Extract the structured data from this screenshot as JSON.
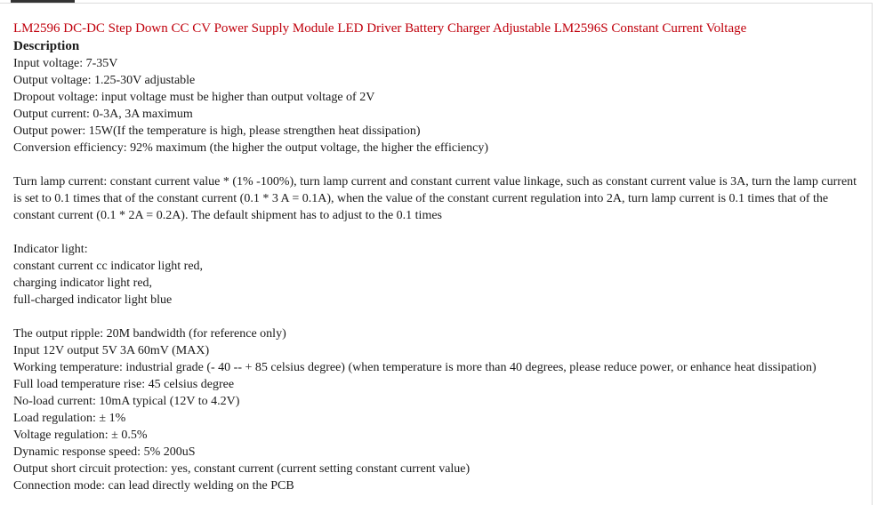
{
  "title": "LM2596 DC-DC Step Down CC CV Power Supply Module LED Driver Battery Charger Adjustable LM2596S Constant Current Voltage",
  "description_heading": "Description",
  "specs": [
    "Input voltage: 7-35V",
    "Output voltage: 1.25-30V adjustable",
    "Dropout voltage: input voltage must be higher than output voltage of 2V",
    "Output current: 0-3A, 3A maximum",
    "Output power: 15W(If the temperature is high, please strengthen heat dissipation)",
    "Conversion efficiency: 92% maximum (the higher the output voltage, the higher the efficiency)"
  ],
  "turn_lamp_paragraph": "Turn lamp current: constant current value * (1% -100%), turn lamp current and constant current value linkage, such as constant current value is 3A, turn the lamp current is set to 0.1 times that of the constant current (0.1 * 3 A = 0.1A), when the value of the constant current regulation into 2A, turn lamp current is 0.1 times that of the constant current (0.1 * 2A = 0.2A). The default shipment has to adjust to the 0.1 times",
  "indicator": [
    "Indicator light:",
    "constant current cc indicator light red,",
    "charging indicator light red,",
    "full-charged indicator light blue"
  ],
  "more_specs": [
    "The output ripple: 20M bandwidth (for reference only)",
    "Input 12V output 5V 3A 60mV (MAX)",
    "Working temperature: industrial grade (- 40 -- + 85 celsius degree) (when temperature is more than 40 degrees, please reduce power, or enhance heat dissipation)",
    "Full load temperature rise: 45 celsius degree",
    "No-load current: 10mA typical (12V to 4.2V)",
    "Load regulation: ± 1%",
    "Voltage regulation: ± 0.5%",
    "Dynamic response speed: 5% 200uS",
    "Output short circuit protection: yes, constant current (current setting constant current value)",
    "Connection mode: can lead directly welding on the PCB"
  ]
}
